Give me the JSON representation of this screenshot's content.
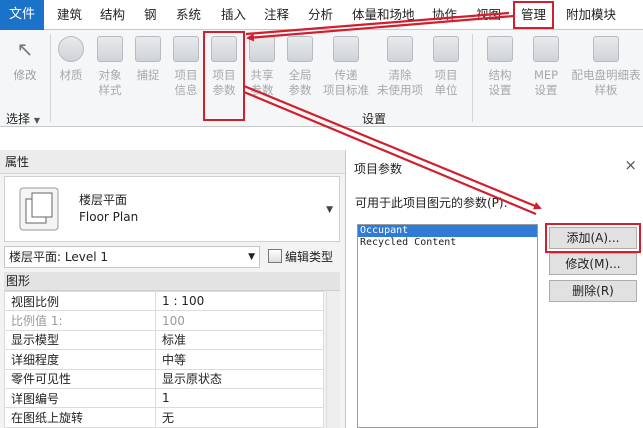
{
  "colors": {
    "file_tab": "#1a73c8",
    "highlight": "#d0202e",
    "selection": "#2f7bd6"
  },
  "tabs": [
    "文件",
    "建筑",
    "结构",
    "钢",
    "系统",
    "插入",
    "注释",
    "分析",
    "体量和场地",
    "协作",
    "视图",
    "管理",
    "附加模块"
  ],
  "ribbon": {
    "modify": {
      "label": "修改",
      "icon": "cursor-arrow-icon"
    },
    "materials": {
      "label": "材质",
      "icon": "material-sphere-icon"
    },
    "object_styles": {
      "label": "对象\n样式",
      "icon": "object-styles-icon"
    },
    "snaps": {
      "label": "捕捉",
      "icon": "magnet-icon"
    },
    "project_info": {
      "label": "项目\n信息",
      "icon": "project-info-icon"
    },
    "project_params": {
      "label": "项目\n参数",
      "icon": "project-parameters-icon"
    },
    "shared_params": {
      "label": "共享\n参数",
      "icon": "shared-parameters-icon"
    },
    "global_params": {
      "label": "全局\n参数",
      "icon": "global-parameters-icon"
    },
    "transfer_standards": {
      "label": "传递\n项目标准",
      "icon": "transfer-standards-icon"
    },
    "purge_unused": {
      "label": "清除\n未使用项",
      "icon": "purge-icon"
    },
    "project_units": {
      "label": "项目\n单位",
      "icon": "units-icon"
    },
    "structural_settings": {
      "label": "结构\n设置",
      "icon": "structural-settings-icon"
    },
    "mep_settings": {
      "label": "MEP\n设置",
      "icon": "mep-settings-icon"
    },
    "panel_schedules": {
      "label": "配电盘明细表\n样板",
      "icon": "panel-schedule-icon"
    },
    "select_panel": "选择",
    "settings_panel": "设置"
  },
  "properties": {
    "header": "属性",
    "type_name_cn": "楼层平面",
    "type_name_en": "Floor Plan",
    "view_selector": "楼层平面: Level 1",
    "edit_type": "编辑类型",
    "group": "图形",
    "rows": [
      {
        "key": "视图比例",
        "value": "1 : 100",
        "dim": false
      },
      {
        "key": "比例值 1:",
        "value": "100",
        "dim": true
      },
      {
        "key": "显示模型",
        "value": "标准",
        "dim": false
      },
      {
        "key": "详细程度",
        "value": "中等",
        "dim": false
      },
      {
        "key": "零件可见性",
        "value": "显示原状态",
        "dim": false
      },
      {
        "key": "详图编号",
        "value": "1",
        "dim": false
      },
      {
        "key": "在图纸上旋转",
        "value": "无",
        "dim": false
      }
    ]
  },
  "dialog": {
    "title": "项目参数",
    "close": "×",
    "list_label": "可用于此项目图元的参数(P):",
    "params": [
      "Occupant",
      "Recycled Content"
    ],
    "add_button": "添加(A)...",
    "modify_button": "修改(M)...",
    "delete_button": "删除(R)"
  }
}
